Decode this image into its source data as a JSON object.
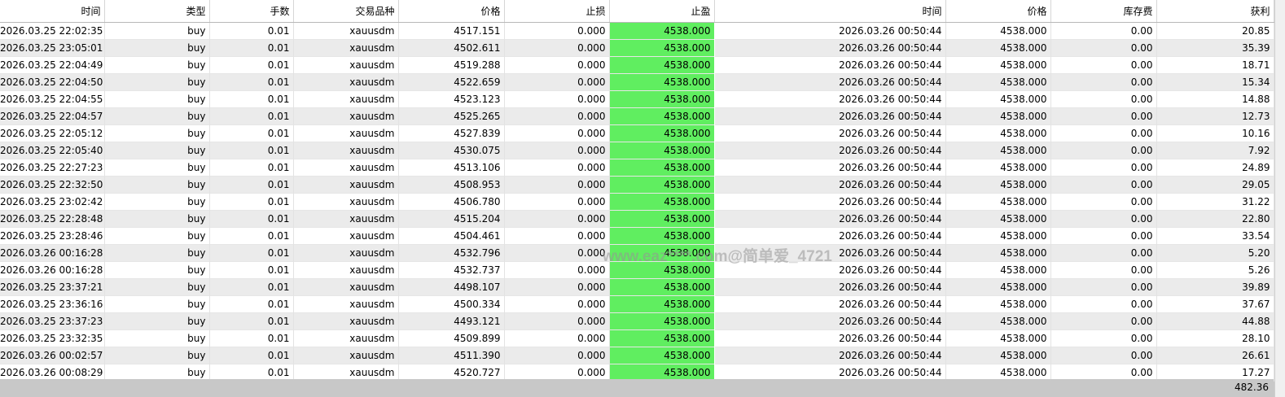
{
  "table": {
    "columns": [
      "时间",
      "类型",
      "手数",
      "交易品种",
      "价格",
      "止损",
      "止盈",
      "时间",
      "价格",
      "库存费",
      "获利"
    ],
    "rows": [
      [
        "2026.03.25 22:02:35",
        "buy",
        "0.01",
        "xauusdm",
        "4517.151",
        "0.000",
        "4538.000",
        "2026.03.26 00:50:44",
        "4538.000",
        "0.00",
        "20.85"
      ],
      [
        "2026.03.25 23:05:01",
        "buy",
        "0.01",
        "xauusdm",
        "4502.611",
        "0.000",
        "4538.000",
        "2026.03.26 00:50:44",
        "4538.000",
        "0.00",
        "35.39"
      ],
      [
        "2026.03.25 22:04:49",
        "buy",
        "0.01",
        "xauusdm",
        "4519.288",
        "0.000",
        "4538.000",
        "2026.03.26 00:50:44",
        "4538.000",
        "0.00",
        "18.71"
      ],
      [
        "2026.03.25 22:04:50",
        "buy",
        "0.01",
        "xauusdm",
        "4522.659",
        "0.000",
        "4538.000",
        "2026.03.26 00:50:44",
        "4538.000",
        "0.00",
        "15.34"
      ],
      [
        "2026.03.25 22:04:55",
        "buy",
        "0.01",
        "xauusdm",
        "4523.123",
        "0.000",
        "4538.000",
        "2026.03.26 00:50:44",
        "4538.000",
        "0.00",
        "14.88"
      ],
      [
        "2026.03.25 22:04:57",
        "buy",
        "0.01",
        "xauusdm",
        "4525.265",
        "0.000",
        "4538.000",
        "2026.03.26 00:50:44",
        "4538.000",
        "0.00",
        "12.73"
      ],
      [
        "2026.03.25 22:05:12",
        "buy",
        "0.01",
        "xauusdm",
        "4527.839",
        "0.000",
        "4538.000",
        "2026.03.26 00:50:44",
        "4538.000",
        "0.00",
        "10.16"
      ],
      [
        "2026.03.25 22:05:40",
        "buy",
        "0.01",
        "xauusdm",
        "4530.075",
        "0.000",
        "4538.000",
        "2026.03.26 00:50:44",
        "4538.000",
        "0.00",
        "7.92"
      ],
      [
        "2026.03.25 22:27:23",
        "buy",
        "0.01",
        "xauusdm",
        "4513.106",
        "0.000",
        "4538.000",
        "2026.03.26 00:50:44",
        "4538.000",
        "0.00",
        "24.89"
      ],
      [
        "2026.03.25 22:32:50",
        "buy",
        "0.01",
        "xauusdm",
        "4508.953",
        "0.000",
        "4538.000",
        "2026.03.26 00:50:44",
        "4538.000",
        "0.00",
        "29.05"
      ],
      [
        "2026.03.25 23:02:42",
        "buy",
        "0.01",
        "xauusdm",
        "4506.780",
        "0.000",
        "4538.000",
        "2026.03.26 00:50:44",
        "4538.000",
        "0.00",
        "31.22"
      ],
      [
        "2026.03.25 22:28:48",
        "buy",
        "0.01",
        "xauusdm",
        "4515.204",
        "0.000",
        "4538.000",
        "2026.03.26 00:50:44",
        "4538.000",
        "0.00",
        "22.80"
      ],
      [
        "2026.03.25 23:28:46",
        "buy",
        "0.01",
        "xauusdm",
        "4504.461",
        "0.000",
        "4538.000",
        "2026.03.26 00:50:44",
        "4538.000",
        "0.00",
        "33.54"
      ],
      [
        "2026.03.26 00:16:28",
        "buy",
        "0.01",
        "xauusdm",
        "4532.796",
        "0.000",
        "4538.000",
        "2026.03.26 00:50:44",
        "4538.000",
        "0.00",
        "5.20"
      ],
      [
        "2026.03.26 00:16:28",
        "buy",
        "0.01",
        "xauusdm",
        "4532.737",
        "0.000",
        "4538.000",
        "2026.03.26 00:50:44",
        "4538.000",
        "0.00",
        "5.26"
      ],
      [
        "2026.03.25 23:37:21",
        "buy",
        "0.01",
        "xauusdm",
        "4498.107",
        "0.000",
        "4538.000",
        "2026.03.26 00:50:44",
        "4538.000",
        "0.00",
        "39.89"
      ],
      [
        "2026.03.25 23:36:16",
        "buy",
        "0.01",
        "xauusdm",
        "4500.334",
        "0.000",
        "4538.000",
        "2026.03.26 00:50:44",
        "4538.000",
        "0.00",
        "37.67"
      ],
      [
        "2026.03.25 23:37:23",
        "buy",
        "0.01",
        "xauusdm",
        "4493.121",
        "0.000",
        "4538.000",
        "2026.03.26 00:50:44",
        "4538.000",
        "0.00",
        "44.88"
      ],
      [
        "2026.03.25 23:32:35",
        "buy",
        "0.01",
        "xauusdm",
        "4509.899",
        "0.000",
        "4538.000",
        "2026.03.26 00:50:44",
        "4538.000",
        "0.00",
        "28.10"
      ],
      [
        "2026.03.26 00:02:57",
        "buy",
        "0.01",
        "xauusdm",
        "4511.390",
        "0.000",
        "4538.000",
        "2026.03.26 00:50:44",
        "4538.000",
        "0.00",
        "26.61"
      ],
      [
        "2026.03.26 00:08:29",
        "buy",
        "0.01",
        "xauusdm",
        "4520.727",
        "0.000",
        "4538.000",
        "2026.03.26 00:50:44",
        "4538.000",
        "0.00",
        "17.27"
      ]
    ]
  },
  "footer": {
    "total_profit": "482.36"
  },
  "watermark": {
    "text": "www.eaz****.com@简单爱_4721"
  },
  "colors": {
    "take_profit_highlight": "#60ee60",
    "alt_row": "#ebebeb",
    "footer_bar": "#c8c8c8"
  }
}
